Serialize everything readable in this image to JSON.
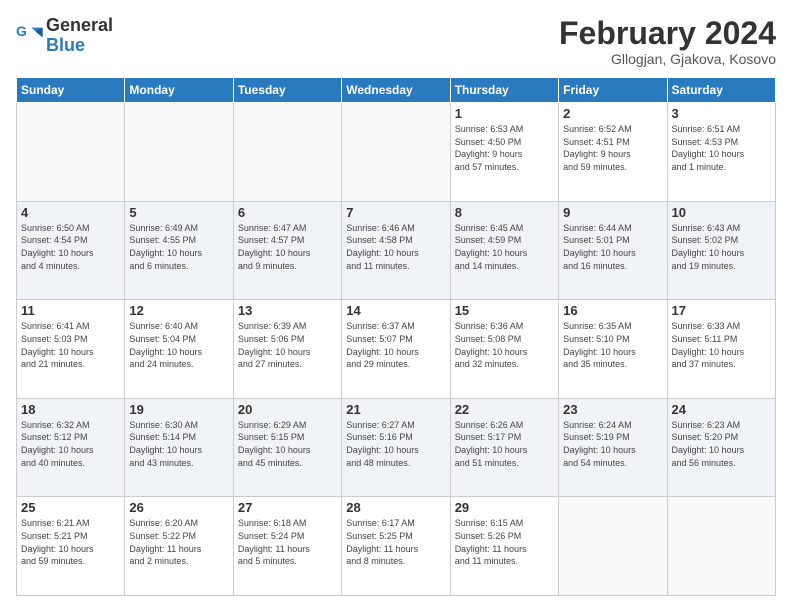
{
  "header": {
    "logo_line1": "General",
    "logo_line2": "Blue",
    "month": "February 2024",
    "location": "Gllogjan, Gjakova, Kosovo"
  },
  "weekdays": [
    "Sunday",
    "Monday",
    "Tuesday",
    "Wednesday",
    "Thursday",
    "Friday",
    "Saturday"
  ],
  "weeks": [
    [
      {
        "day": "",
        "info": ""
      },
      {
        "day": "",
        "info": ""
      },
      {
        "day": "",
        "info": ""
      },
      {
        "day": "",
        "info": ""
      },
      {
        "day": "1",
        "info": "Sunrise: 6:53 AM\nSunset: 4:50 PM\nDaylight: 9 hours\nand 57 minutes."
      },
      {
        "day": "2",
        "info": "Sunrise: 6:52 AM\nSunset: 4:51 PM\nDaylight: 9 hours\nand 59 minutes."
      },
      {
        "day": "3",
        "info": "Sunrise: 6:51 AM\nSunset: 4:53 PM\nDaylight: 10 hours\nand 1 minute."
      }
    ],
    [
      {
        "day": "4",
        "info": "Sunrise: 6:50 AM\nSunset: 4:54 PM\nDaylight: 10 hours\nand 4 minutes."
      },
      {
        "day": "5",
        "info": "Sunrise: 6:49 AM\nSunset: 4:55 PM\nDaylight: 10 hours\nand 6 minutes."
      },
      {
        "day": "6",
        "info": "Sunrise: 6:47 AM\nSunset: 4:57 PM\nDaylight: 10 hours\nand 9 minutes."
      },
      {
        "day": "7",
        "info": "Sunrise: 6:46 AM\nSunset: 4:58 PM\nDaylight: 10 hours\nand 11 minutes."
      },
      {
        "day": "8",
        "info": "Sunrise: 6:45 AM\nSunset: 4:59 PM\nDaylight: 10 hours\nand 14 minutes."
      },
      {
        "day": "9",
        "info": "Sunrise: 6:44 AM\nSunset: 5:01 PM\nDaylight: 10 hours\nand 16 minutes."
      },
      {
        "day": "10",
        "info": "Sunrise: 6:43 AM\nSunset: 5:02 PM\nDaylight: 10 hours\nand 19 minutes."
      }
    ],
    [
      {
        "day": "11",
        "info": "Sunrise: 6:41 AM\nSunset: 5:03 PM\nDaylight: 10 hours\nand 21 minutes."
      },
      {
        "day": "12",
        "info": "Sunrise: 6:40 AM\nSunset: 5:04 PM\nDaylight: 10 hours\nand 24 minutes."
      },
      {
        "day": "13",
        "info": "Sunrise: 6:39 AM\nSunset: 5:06 PM\nDaylight: 10 hours\nand 27 minutes."
      },
      {
        "day": "14",
        "info": "Sunrise: 6:37 AM\nSunset: 5:07 PM\nDaylight: 10 hours\nand 29 minutes."
      },
      {
        "day": "15",
        "info": "Sunrise: 6:36 AM\nSunset: 5:08 PM\nDaylight: 10 hours\nand 32 minutes."
      },
      {
        "day": "16",
        "info": "Sunrise: 6:35 AM\nSunset: 5:10 PM\nDaylight: 10 hours\nand 35 minutes."
      },
      {
        "day": "17",
        "info": "Sunrise: 6:33 AM\nSunset: 5:11 PM\nDaylight: 10 hours\nand 37 minutes."
      }
    ],
    [
      {
        "day": "18",
        "info": "Sunrise: 6:32 AM\nSunset: 5:12 PM\nDaylight: 10 hours\nand 40 minutes."
      },
      {
        "day": "19",
        "info": "Sunrise: 6:30 AM\nSunset: 5:14 PM\nDaylight: 10 hours\nand 43 minutes."
      },
      {
        "day": "20",
        "info": "Sunrise: 6:29 AM\nSunset: 5:15 PM\nDaylight: 10 hours\nand 45 minutes."
      },
      {
        "day": "21",
        "info": "Sunrise: 6:27 AM\nSunset: 5:16 PM\nDaylight: 10 hours\nand 48 minutes."
      },
      {
        "day": "22",
        "info": "Sunrise: 6:26 AM\nSunset: 5:17 PM\nDaylight: 10 hours\nand 51 minutes."
      },
      {
        "day": "23",
        "info": "Sunrise: 6:24 AM\nSunset: 5:19 PM\nDaylight: 10 hours\nand 54 minutes."
      },
      {
        "day": "24",
        "info": "Sunrise: 6:23 AM\nSunset: 5:20 PM\nDaylight: 10 hours\nand 56 minutes."
      }
    ],
    [
      {
        "day": "25",
        "info": "Sunrise: 6:21 AM\nSunset: 5:21 PM\nDaylight: 10 hours\nand 59 minutes."
      },
      {
        "day": "26",
        "info": "Sunrise: 6:20 AM\nSunset: 5:22 PM\nDaylight: 11 hours\nand 2 minutes."
      },
      {
        "day": "27",
        "info": "Sunrise: 6:18 AM\nSunset: 5:24 PM\nDaylight: 11 hours\nand 5 minutes."
      },
      {
        "day": "28",
        "info": "Sunrise: 6:17 AM\nSunset: 5:25 PM\nDaylight: 11 hours\nand 8 minutes."
      },
      {
        "day": "29",
        "info": "Sunrise: 6:15 AM\nSunset: 5:26 PM\nDaylight: 11 hours\nand 11 minutes."
      },
      {
        "day": "",
        "info": ""
      },
      {
        "day": "",
        "info": ""
      }
    ]
  ]
}
